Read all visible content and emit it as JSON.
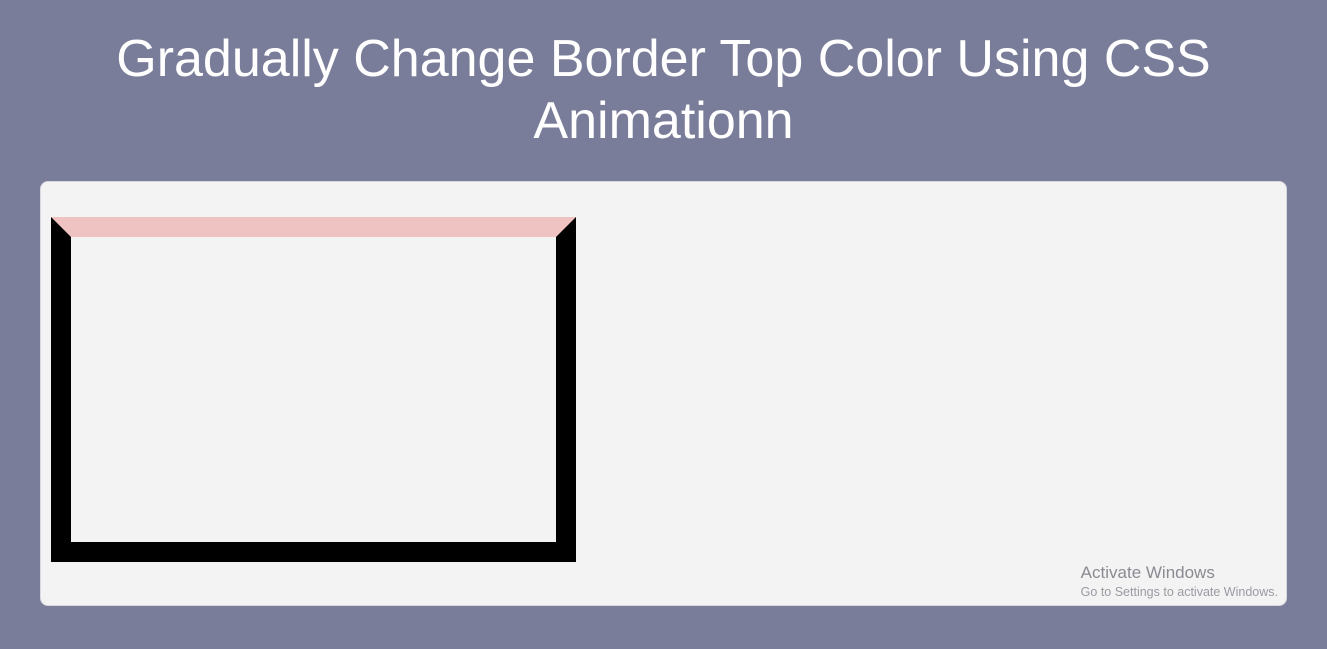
{
  "title": "Gradually Change Border Top Color Using CSS Animationn",
  "demo": {
    "border_top_color": "#efc3c2",
    "border_other_color": "#000000",
    "border_width_px": 20,
    "inner_background": "#f4f3f3"
  },
  "watermark": {
    "title": "Activate Windows",
    "subtitle": "Go to Settings to activate Windows."
  },
  "colors": {
    "page_background": "#7a7d99",
    "panel_background": "#f4f3f3",
    "title_color": "#ffffff"
  }
}
